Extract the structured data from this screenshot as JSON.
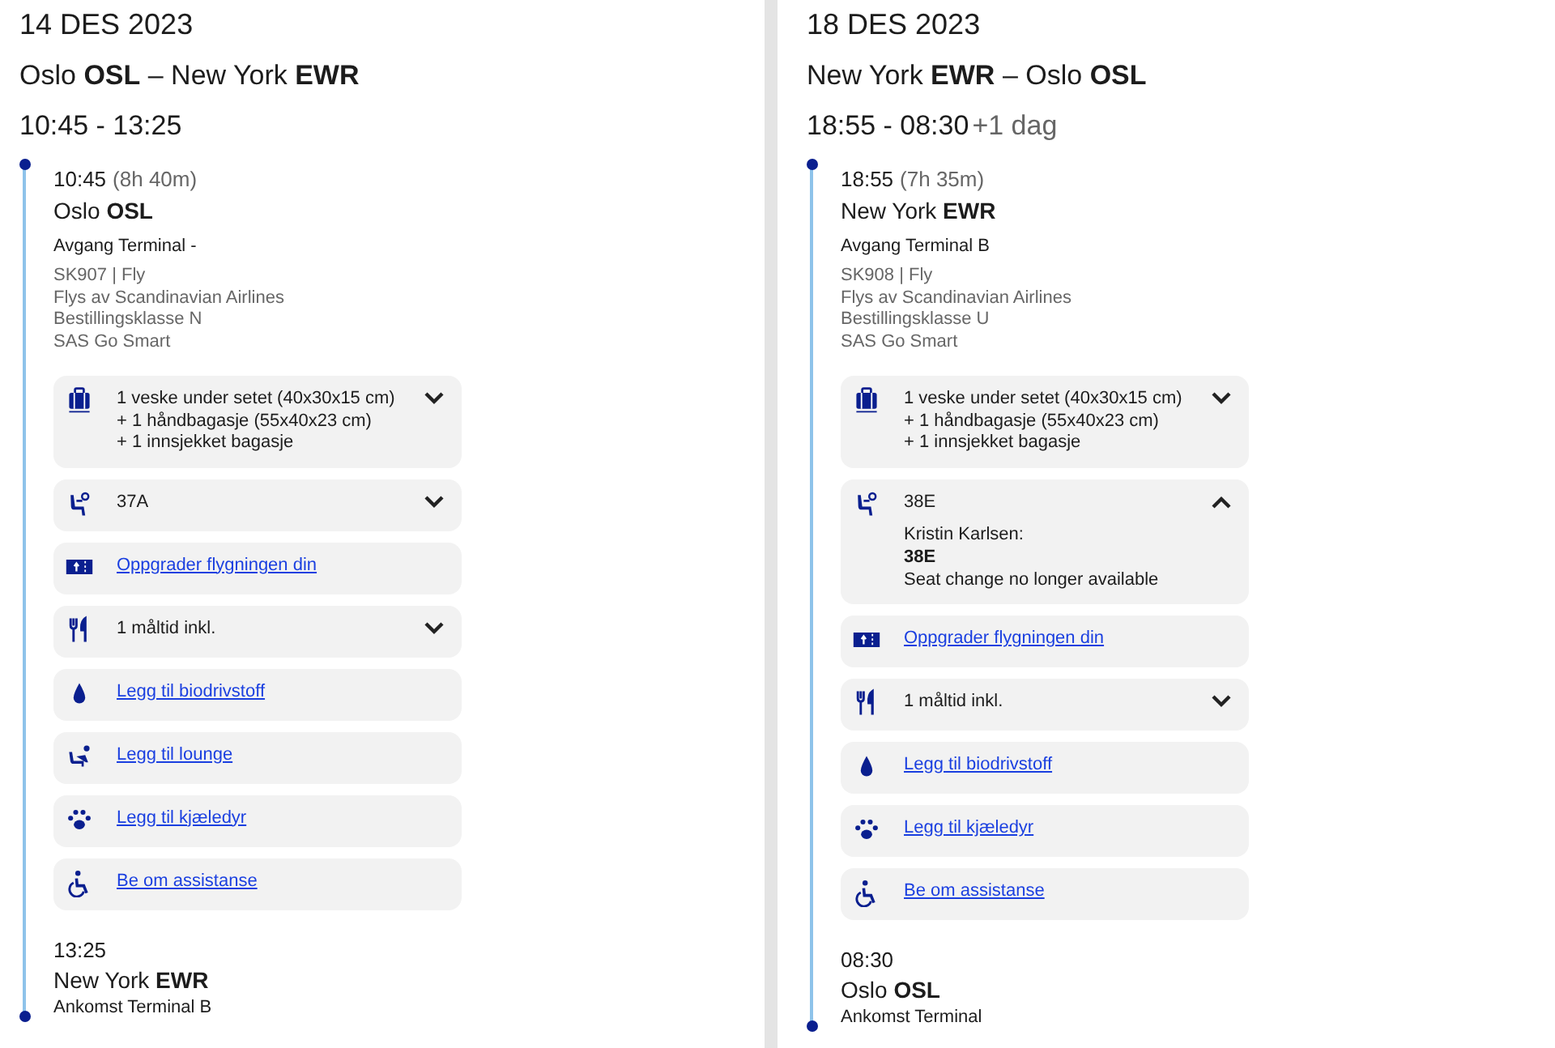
{
  "journeys": [
    {
      "date": "14 DES 2023",
      "route": "Oslo **OSL** – New York **EWR**",
      "times": "10:45 - 13:25",
      "departure": {
        "time": "10:45",
        "duration": "(8h 40m)",
        "place": "Oslo **OSL**",
        "terminal": "Avgang Terminal -",
        "details": [
          "SK907 | Fly",
          "Flys av Scandinavian Airlines",
          "Bestillingsklasse N",
          "SAS Go Smart"
        ]
      },
      "services": [
        {
          "kind": "baggage",
          "lines": [
            "1 veske under setet (40x30x15 cm)",
            "+ 1 håndbagasje (55x40x23 cm)",
            "+ 1 innsjekket bagasje"
          ],
          "expanded": false
        },
        {
          "kind": "seat",
          "lines": [
            "37A"
          ],
          "expanded": false
        },
        {
          "kind": "upgrade",
          "link": "Oppgrader flygningen din"
        },
        {
          "kind": "meal",
          "lines": [
            "1 måltid inkl."
          ],
          "expanded": false
        },
        {
          "kind": "biofuel",
          "link": "Legg til biodrivstoff"
        },
        {
          "kind": "lounge",
          "link": "Legg til lounge"
        },
        {
          "kind": "pet",
          "link": "Legg til kjæledyr"
        },
        {
          "kind": "assistance",
          "link": "Be om assistanse"
        }
      ],
      "arrival": {
        "time": "13:25",
        "place": "New York **EWR**",
        "terminal": "Ankomst Terminal B"
      }
    },
    {
      "date": "18 DES 2023",
      "route": "New York **EWR** – Oslo **OSL**",
      "times": "18:55 - 08:30",
      "day_offset": "+1 dag",
      "departure": {
        "time": "18:55",
        "duration": "(7h 35m)",
        "place": "New York **EWR**",
        "terminal": "Avgang Terminal B",
        "details": [
          "SK908 | Fly",
          "Flys av Scandinavian Airlines",
          "Bestillingsklasse U",
          "SAS Go Smart"
        ]
      },
      "services": [
        {
          "kind": "baggage",
          "lines": [
            "1 veske under setet (40x30x15 cm)",
            "+ 1 håndbagasje (55x40x23 cm)",
            "+ 1 innsjekket bagasje"
          ],
          "expanded": false
        },
        {
          "kind": "seat",
          "lines": [
            "38E"
          ],
          "expanded": true,
          "passenger": "Kristin Karlsen:",
          "seat": "38E",
          "note": "Seat change no longer available"
        },
        {
          "kind": "upgrade",
          "link": "Oppgrader flygningen din"
        },
        {
          "kind": "meal",
          "lines": [
            "1 måltid inkl."
          ],
          "expanded": false
        },
        {
          "kind": "biofuel",
          "link": "Legg til biodrivstoff"
        },
        {
          "kind": "pet",
          "link": "Legg til kjæledyr"
        },
        {
          "kind": "assistance",
          "link": "Be om assistanse"
        }
      ],
      "arrival": {
        "time": "08:30",
        "place": "Oslo **OSL**",
        "terminal": "Ankomst Terminal"
      }
    }
  ]
}
